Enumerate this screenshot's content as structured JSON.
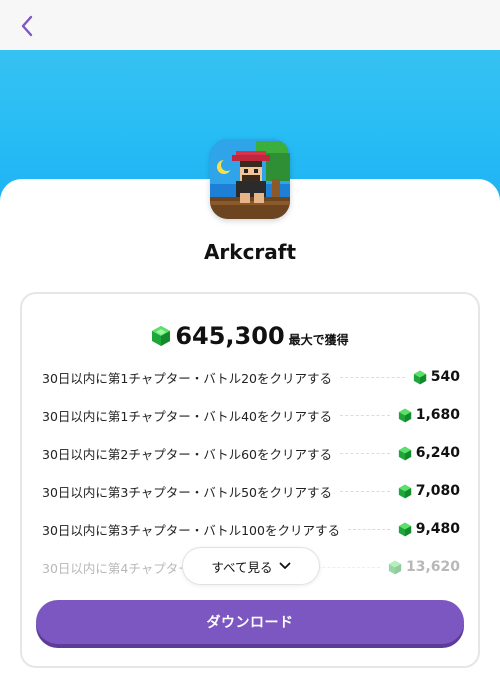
{
  "header": {
    "back_icon": "chevron-left-icon",
    "accent_color": "#7d57c1"
  },
  "app": {
    "name": "Arkcraft",
    "icon": "arkcraft-app-icon"
  },
  "rewards": {
    "total_value": "645,300",
    "total_suffix": "最大で獲得",
    "gem_icon": "green-gem-icon",
    "items": [
      {
        "label": "30日以内に第1チャプター・バトル20をクリアする",
        "value": "540"
      },
      {
        "label": "30日以内に第1チャプター・バトル40をクリアする",
        "value": "1,680"
      },
      {
        "label": "30日以内に第2チャプター・バトル60をクリアする",
        "value": "6,240"
      },
      {
        "label": "30日以内に第3チャプター・バトル50をクリアする",
        "value": "7,080"
      },
      {
        "label": "30日以内に第3チャプター・バトル100をクリアする",
        "value": "9,480"
      },
      {
        "label": "30日以内に第4チャプター",
        "value": "13,620"
      }
    ],
    "see_all_label": "すべて見る"
  },
  "download_label": "ダウンロード"
}
